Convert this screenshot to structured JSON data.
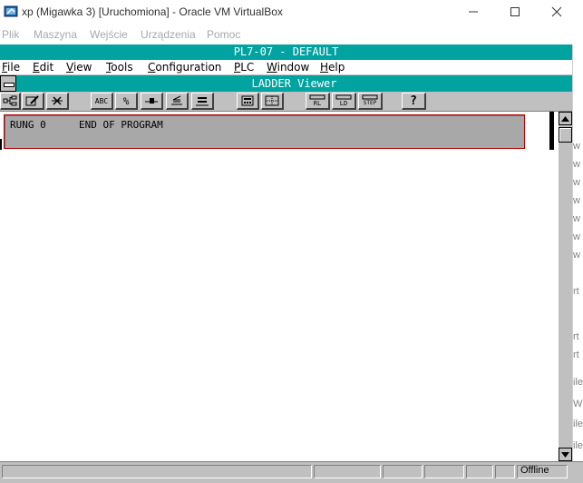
{
  "host": {
    "title": "xp (Migawka 3) [Uruchomiona] - Oracle VM VirtualBox",
    "menu": [
      "Plik",
      "Maszyna",
      "Wejście",
      "Urządzenia",
      "Pomoc"
    ],
    "icon": "virtualbox-icon"
  },
  "app": {
    "title": "PL7-07 - DEFAULT",
    "menu": [
      {
        "label": "File",
        "ul": "F"
      },
      {
        "label": "Edit",
        "ul": "E"
      },
      {
        "label": "View",
        "ul": "V"
      },
      {
        "label": "Tools",
        "ul": "T"
      },
      {
        "label": "Configuration",
        "ul": "C"
      },
      {
        "label": "PLC",
        "ul": "P"
      },
      {
        "label": "Window",
        "ul": "W"
      },
      {
        "label": "Help",
        "ul": "H"
      }
    ]
  },
  "viewer": {
    "title": "LADDER Viewer"
  },
  "toolbar": {
    "abc": "ABC",
    "percent": "%",
    "help": "?",
    "rl": "RL",
    "ld": "LD",
    "step": "STEP"
  },
  "rung": {
    "label": "RUNG 0",
    "text": "END OF PROGRAM"
  },
  "edge_chars": [
    "w",
    "w",
    "w",
    "w",
    "w",
    "w",
    "w",
    "rt",
    "rt",
    "rt",
    "ile",
    "W",
    "ile",
    "ile"
  ],
  "status": {
    "text": "Offline"
  }
}
